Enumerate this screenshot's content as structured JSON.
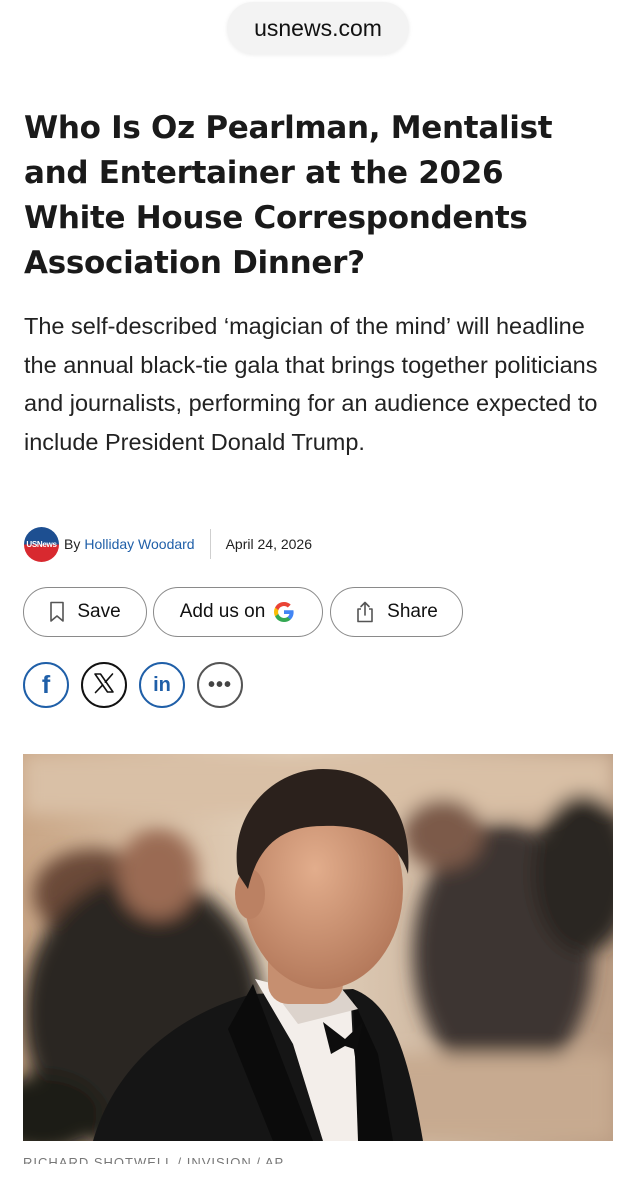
{
  "browser": {
    "url": "usnews.com"
  },
  "article": {
    "headline": "Who Is Oz Pearlman, Mentalist and Entertainer at the 2026 White House Correspondents Association Dinner?",
    "dek": "The self-described ‘magician of the mind’ will headline the annual black-tie gala that brings together politicians and journalists, performing for an audience expected to include President Donald Trump.",
    "byline": {
      "logo_text": "USNews",
      "by": "By",
      "author": "Holliday Woodard",
      "date": "April 24, 2026"
    },
    "actions": {
      "save": "Save",
      "add_us_on": "Add us on",
      "share": "Share"
    },
    "social": {
      "facebook": "f",
      "linkedin": "in",
      "more": "•••",
      "icons": [
        "facebook-icon",
        "x-icon",
        "linkedin-icon",
        "more-icon"
      ]
    },
    "photo": {
      "caption_partial": "RICHARD SHOTWELL / INVISION / AP"
    }
  },
  "colors": {
    "link_blue": "#1f5fa8",
    "logo_blue": "#1d4f91",
    "logo_red": "#d8292f",
    "google_blue": "#4285F4",
    "google_red": "#EA4335",
    "google_yellow": "#FBBC05",
    "google_green": "#34A853"
  }
}
